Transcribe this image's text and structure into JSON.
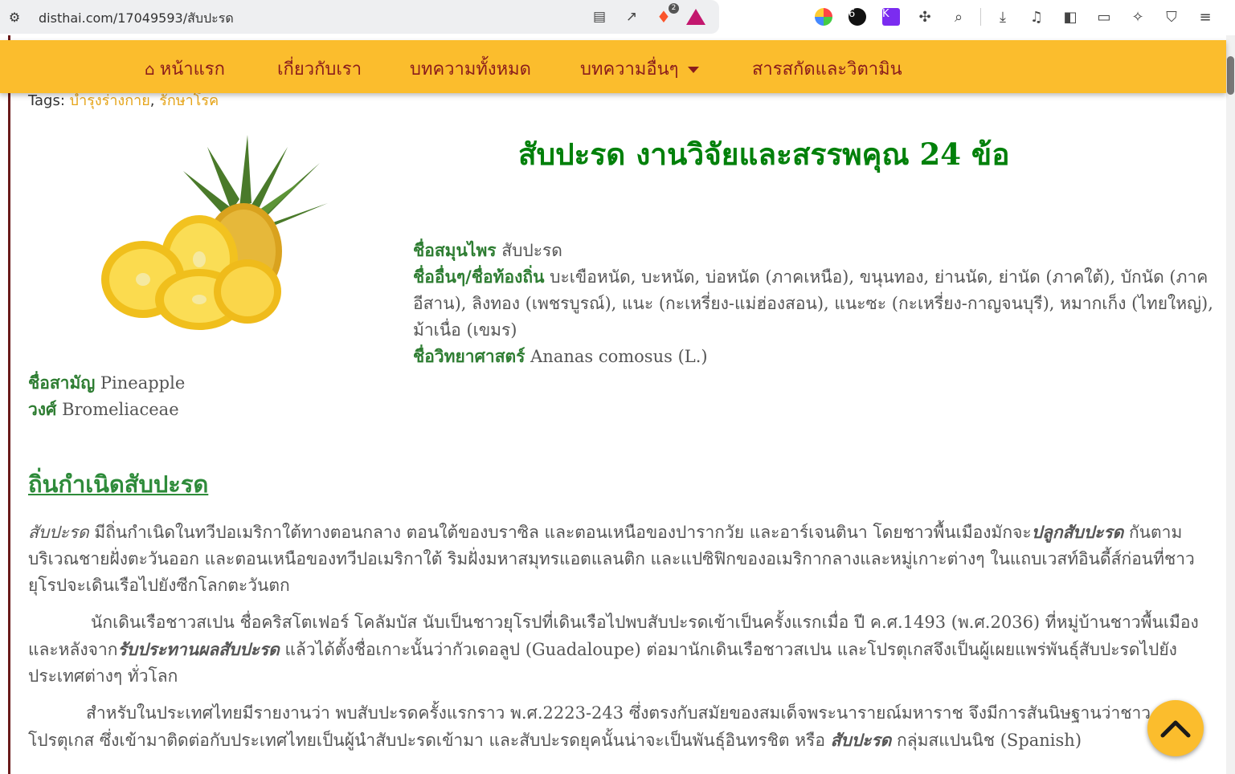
{
  "browser": {
    "url": "disthai.com/17049593/สับปะรด",
    "brave_badge": "2"
  },
  "nav": {
    "items": [
      {
        "label": "หน้าแรก"
      },
      {
        "label": "เกี่ยวกับเรา"
      },
      {
        "label": "บทความทั้งหมด"
      },
      {
        "label": "บทความอื่นๆ"
      },
      {
        "label": "สารสกัดและวิตามิน"
      }
    ]
  },
  "tags": {
    "label": "Tags:",
    "items": [
      "บำรุงร่างกาย",
      "รักษาโรค"
    ]
  },
  "article": {
    "title": "สับปะรด งานวิจัยและสรรพคุณ 24 ข้อ",
    "herb_name_label": "ชื่อสมุนไพร",
    "herb_name": "สับปะรด",
    "other_names_label": "ชื่ออื่นๆ/ชื่อท้องถิ่น",
    "other_names": "บะเขือหนัด, บะหนัด, บ่อหนัด (ภาคเหนือ), ขนุนทอง, ย่านนัด, ย่านัด (ภาคใต้), บักนัด (ภาคอีสาน), ลิงทอง (เพชรบูรณ์), แนะ (กะเหรี่ยง-แม่ฮ่องสอน), แนะซะ (กะเหรี่ยง-กาญจนบุรี), หมากเก็ง (ไทยใหญ่), ม้าเนื่อ (เขมร)",
    "sci_name_label": "ชื่อวิทยาศาสตร์",
    "sci_name": "Ananas comosus (L.)",
    "common_name_label": "ชื่อสามัญ",
    "common_name": "Pineapple",
    "family_label": "วงศ์",
    "family": "Bromeliaceae",
    "section_heading": "ถิ่นกำเนิดสับปะรด",
    "p1": {
      "a": "สับปะรด",
      "b": " มีถิ่นกำเนิดในทวีปอเมริกาใต้ทางตอนกลาง ตอนใต้ของบราซิล และตอนเหนือของปารากวัย และอาร์เจนตินา โดยชาวพื้นเมืองมักจะ",
      "c": "ปลูกสับปะรด",
      "d": " กันตามบริเวณชายฝั่งตะวันออก และตอนเหนือของทวีปอเมริกาใต้ ริมฝั่งมหาสมุทรแอตแลนติก และแปซิฟิกของอเมริกากลางและหมู่เกาะต่างๆ ในแถบเวสท์อินดี้ส์ก่อนที่ชาวยุโรปจะเดินเรือไปยังซีกโลกตะวันตก"
    },
    "p2": {
      "a": "นักเดินเรือชาวสเปน ชื่อคริสโตเฟอร์ โคลัมบัส นับเป็นชาวยุโรปที่เดินเรือไปพบสับปะรดเข้าเป็นครั้งแรกเมื่อ ปี ค.ศ.1493 (พ.ศ.2036) ที่หมู่บ้านชาวพื้นเมือง และหลังจาก",
      "b": "รับประทานผลสับปะรด",
      "c": " แล้วได้ตั้งชื่อเกาะนั้นว่ากัวเดอลูป (Guadaloupe) ต่อมานักเดินเรือชาวสเปน และโปรตุเกสจึงเป็นผู้เผยแพร่พันธุ์สับปะรดไปยังประเทศต่างๆ ทั่วโลก"
    },
    "p3": {
      "a": "สำหรับในประเทศไทยมีรายงานว่า พบสับปะรดครั้งแรกราว พ.ศ.2223-243 ซึ่งตรงกับสมัยของสมเด็จพระนารายณ์มหาราช จึงมีการสันนิษฐานว่าชาวโปรตุเกส ซึ่งเข้ามาติดต่อกับประเทศไทยเป็นผู้นำสับปะรดเข้ามา และสับปะรดยุคนั้นน่าจะเป็นพันธุ์อินทรชิต หรือ ",
      "b": "สับปะรด",
      "c": " กลุ่มสแปนนิช (Spanish)"
    }
  },
  "colors": {
    "nav_bg": "#fbbd2d",
    "nav_text": "#8a1c1c",
    "title_green": "#00800a",
    "label_green": "#2e7d32",
    "tag_link": "#e6a417"
  }
}
